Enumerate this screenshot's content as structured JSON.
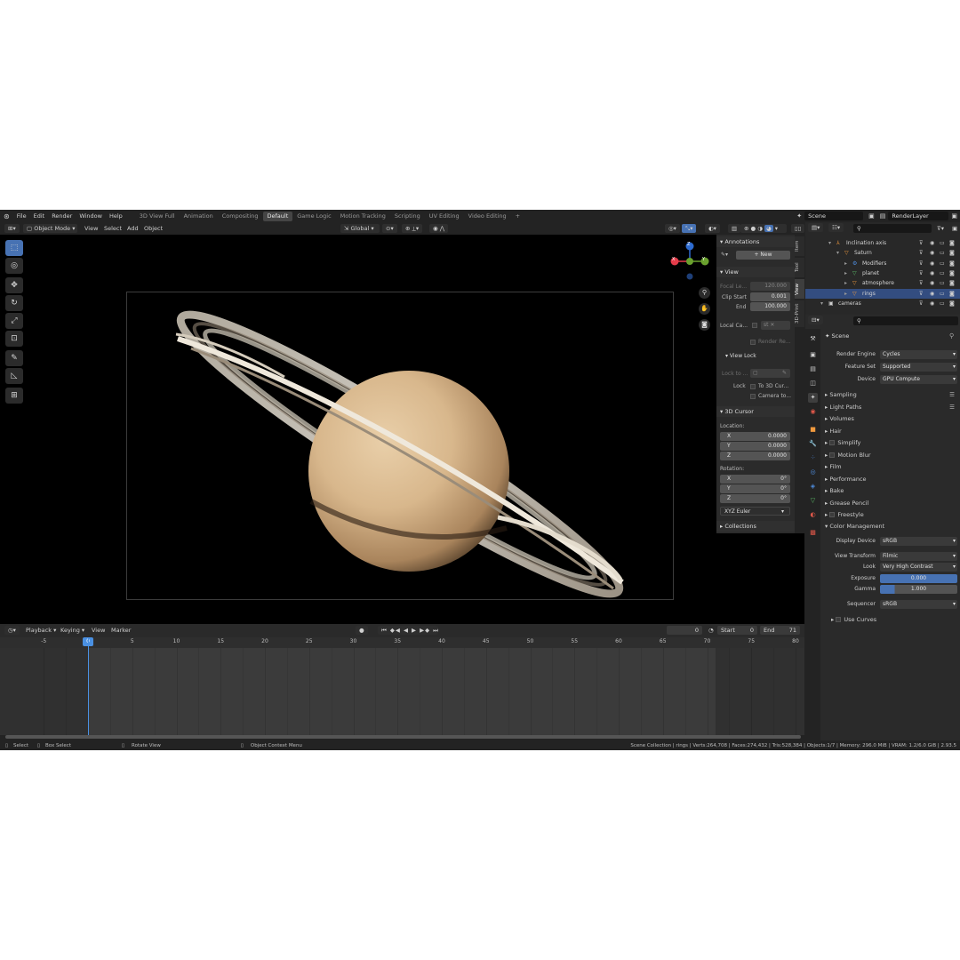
{
  "topbar": {
    "menus": [
      "File",
      "Edit",
      "Render",
      "Window",
      "Help"
    ],
    "workspaces": [
      "3D View Full",
      "Animation",
      "Compositing",
      "Default",
      "Game Logic",
      "Motion Tracking",
      "Scripting",
      "UV Editing",
      "Video Editing"
    ],
    "active_workspace": "Default",
    "add_tab": "+",
    "scene": "Scene",
    "view_layer": "RenderLayer"
  },
  "viewport_header": {
    "mode": "Object Mode",
    "menus": [
      "View",
      "Select",
      "Add",
      "Object"
    ],
    "orientation": "Global"
  },
  "npanel": {
    "annotations": {
      "title": "Annotations",
      "new_label": "New"
    },
    "view": {
      "title": "View",
      "focal_label": "Focal Le...",
      "focal_value": "120.000",
      "clip_start_label": "Clip Start",
      "clip_start_value": "0.001",
      "end_label": "End",
      "end_value": "100.000",
      "local_camera_label": "Local Ca...",
      "local_camera_value": "st",
      "render_region_label": "Render Re...",
      "view_lock_title": "View Lock",
      "lock_to_label": "Lock to ...",
      "lock_label": "Lock",
      "to_3d_cursor": "To 3D Cur...",
      "camera_to": "Camera to..."
    },
    "cursor": {
      "title": "3D Cursor",
      "location_label": "Location:",
      "loc": [
        {
          "axis": "X",
          "value": "0.0000"
        },
        {
          "axis": "Y",
          "value": "0.0000"
        },
        {
          "axis": "Z",
          "value": "0.0000"
        }
      ],
      "rotation_label": "Rotation:",
      "rot": [
        {
          "axis": "X",
          "value": "0°"
        },
        {
          "axis": "Y",
          "value": "0°"
        },
        {
          "axis": "Z",
          "value": "0°"
        }
      ],
      "rotation_mode": "XYZ Euler"
    },
    "collections": "Collections",
    "tabs": [
      "Item",
      "Tool",
      "View",
      "3D-Print"
    ],
    "active_tab": "View"
  },
  "gizmo": {
    "x": "X",
    "y": "Y",
    "z": "Z"
  },
  "timeline": {
    "menus": [
      "Playback",
      "Keying",
      "View",
      "Marker"
    ],
    "current_frame": "0",
    "start_label": "Start",
    "start_value": "0",
    "end_label": "End",
    "end_value": "71",
    "ticks": [
      "-5",
      "0",
      "5",
      "10",
      "15",
      "20",
      "25",
      "30",
      "35",
      "40",
      "45",
      "50",
      "55",
      "60",
      "65",
      "70",
      "75",
      "80"
    ]
  },
  "status": {
    "select": "Select",
    "box_select": "Box Select",
    "rotate_view": "Rotate View",
    "context_menu": "Object Context Menu",
    "stats": "Scene Collection | rings | Verts:264,708 | Faces:274,432 | Tris:528,384 | Objects:1/7 | Memory: 296.0 MiB | VRAM: 1.2/6.0 GiB | 2.93.5"
  },
  "outliner": {
    "rows": [
      {
        "label": "Inclination axis",
        "indent": 2,
        "selected": false
      },
      {
        "label": "Saturn",
        "indent": 3,
        "selected": false
      },
      {
        "label": "Modifiers",
        "indent": 4,
        "selected": false
      },
      {
        "label": "planet",
        "indent": 4,
        "selected": false
      },
      {
        "label": "atmosphere",
        "indent": 4,
        "selected": false
      },
      {
        "label": "rings",
        "indent": 4,
        "selected": true
      },
      {
        "label": "cameras",
        "indent": 1,
        "selected": false
      }
    ]
  },
  "properties": {
    "context": "Scene",
    "render_engine_label": "Render Engine",
    "render_engine": "Cycles",
    "feature_set_label": "Feature Set",
    "feature_set": "Supported",
    "device_label": "Device",
    "device": "GPU Compute",
    "sections": [
      "Sampling",
      "Light Paths",
      "Volumes",
      "Hair",
      "Simplify",
      "Motion Blur",
      "Film",
      "Performance",
      "Bake",
      "Grease Pencil",
      "Freestyle"
    ],
    "color_management": {
      "title": "Color Management",
      "display_device_label": "Display Device",
      "display_device": "sRGB",
      "view_transform_label": "View Transform",
      "view_transform": "Filmic",
      "look_label": "Look",
      "look": "Very High Contrast",
      "exposure_label": "Exposure",
      "exposure": "0.000",
      "gamma_label": "Gamma",
      "gamma": "1.000",
      "sequencer_label": "Sequencer",
      "sequencer": "sRGB",
      "use_curves": "Use Curves"
    }
  },
  "colors": {
    "accent": "#4772b3",
    "selection": "#334d80",
    "playhead": "#4a90e2"
  }
}
